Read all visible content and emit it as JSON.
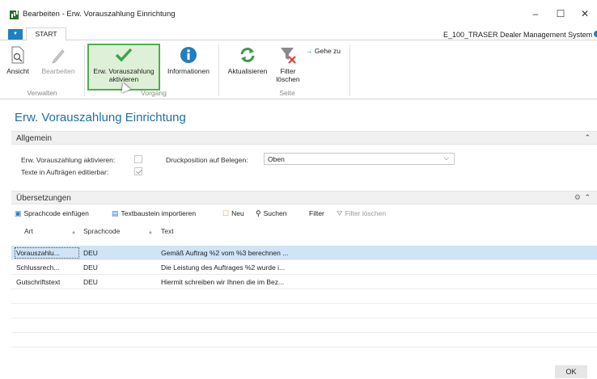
{
  "window": {
    "title": "Bearbeiten - Erw. Vorauszahlung Einrichtung",
    "minimize": "–",
    "maximize": "☐",
    "close": "✕"
  },
  "ribbon": {
    "file_tab": "▼",
    "start_tab": "START",
    "system_name": "E_100_TRASER Dealer Management System",
    "buttons": {
      "view": "Ansicht",
      "edit": "Bearbeiten",
      "activate_line1": "Erw. Vorauszahlung",
      "activate_line2": "aktivieren",
      "info": "Informationen",
      "refresh": "Aktualisieren",
      "clear_filter_line1": "Filter",
      "clear_filter_line2": "löschen",
      "goto": "Gehe zu"
    },
    "groups": {
      "manage": "Verwalten",
      "process": "Vorgang",
      "page": "Seite"
    }
  },
  "page_title": "Erw. Vorauszahlung Einrichtung",
  "general": {
    "header": "Allgemein",
    "activate_label": "Erw. Vorauszahlung aktivieren:",
    "activate_checked": false,
    "edit_texts_label": "Texte in Aufträgen editierbar:",
    "edit_texts_checked": true,
    "print_position_label": "Druckposition auf Belegen:",
    "print_position_value": "Oben"
  },
  "translations": {
    "header": "Übersetzungen",
    "toolbar": {
      "insert_lang": "Sprachcode einfügen",
      "import_text": "Textbaustein importieren",
      "new": "Neu",
      "search": "Suchen",
      "filter": "Filter",
      "clear_filter": "Filter löschen"
    },
    "columns": {
      "art": "Art",
      "lang": "Sprachcode",
      "text": "Text"
    },
    "rows": [
      {
        "art": "Vorauszahlu...",
        "lang": "DEU",
        "text": "Gemäß Auftrag %2 vom %3 berechnen ..."
      },
      {
        "art": "Schlussrech...",
        "lang": "DEU",
        "text": "Die Leistung des Auftrages %2 wurde i..."
      },
      {
        "art": "Gutschriftstext",
        "lang": "DEU",
        "text": "Hiermit schreiben wir Ihnen die im Bez..."
      }
    ]
  },
  "ok_label": "OK",
  "colors": {
    "accent": "#1f7fbf",
    "title_blue": "#1f6fa8",
    "highlight_green": "#4caf50",
    "selected_row": "#cfe4f6"
  }
}
